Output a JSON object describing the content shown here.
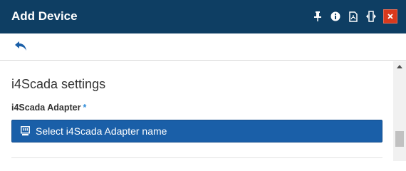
{
  "window": {
    "title": "Add Device",
    "icons": [
      "pin-icon",
      "info-icon",
      "pdf-icon",
      "resize-icon",
      "close-icon"
    ],
    "close_label": "×",
    "titlebar_color": "#0e3e63",
    "close_color": "#d9391c"
  },
  "toolbar": {
    "back_icon": "reply-arrow-icon"
  },
  "section": {
    "title": "i4Scada settings",
    "field_label": "i4Scada Adapter",
    "required_mark": "*",
    "select_button_label": "Select i4Scada Adapter name",
    "select_button_icon": "adapter-icon",
    "button_color": "#1a5fa8"
  }
}
